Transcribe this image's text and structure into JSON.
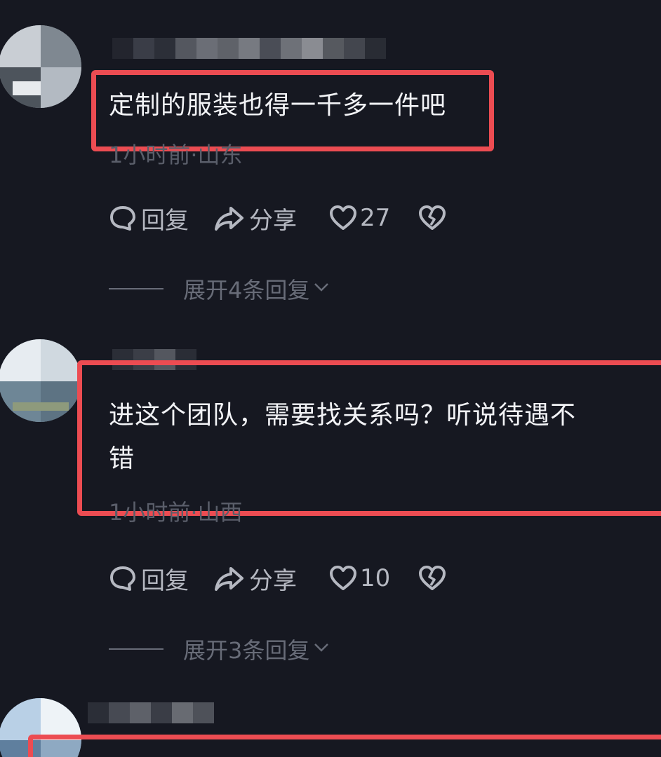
{
  "colors": {
    "background": "#161821",
    "highlight": "#ec4c52",
    "text": "#f2f3f6",
    "muted": "#5a5e6a",
    "action": "#b5b8c1"
  },
  "comments": [
    {
      "text_lines": [
        "定制的服装也得一千多一件吧"
      ],
      "meta": "1小时前·山东",
      "reply_label": "回复",
      "share_label": "分享",
      "like_count": "27",
      "expand_label": "展开4条回复"
    },
    {
      "text_lines": [
        "进这个团队，需要找关系吗？听说待遇不",
        "错"
      ],
      "meta": "1小时前·山西",
      "reply_label": "回复",
      "share_label": "分享",
      "like_count": "10",
      "expand_label": "展开3条回复"
    }
  ],
  "icons": {
    "reply": "comment-bubble-icon",
    "share": "share-arrow-icon",
    "like": "heart-icon",
    "dislike": "broken-heart-icon",
    "expand": "chevron-down-icon"
  }
}
